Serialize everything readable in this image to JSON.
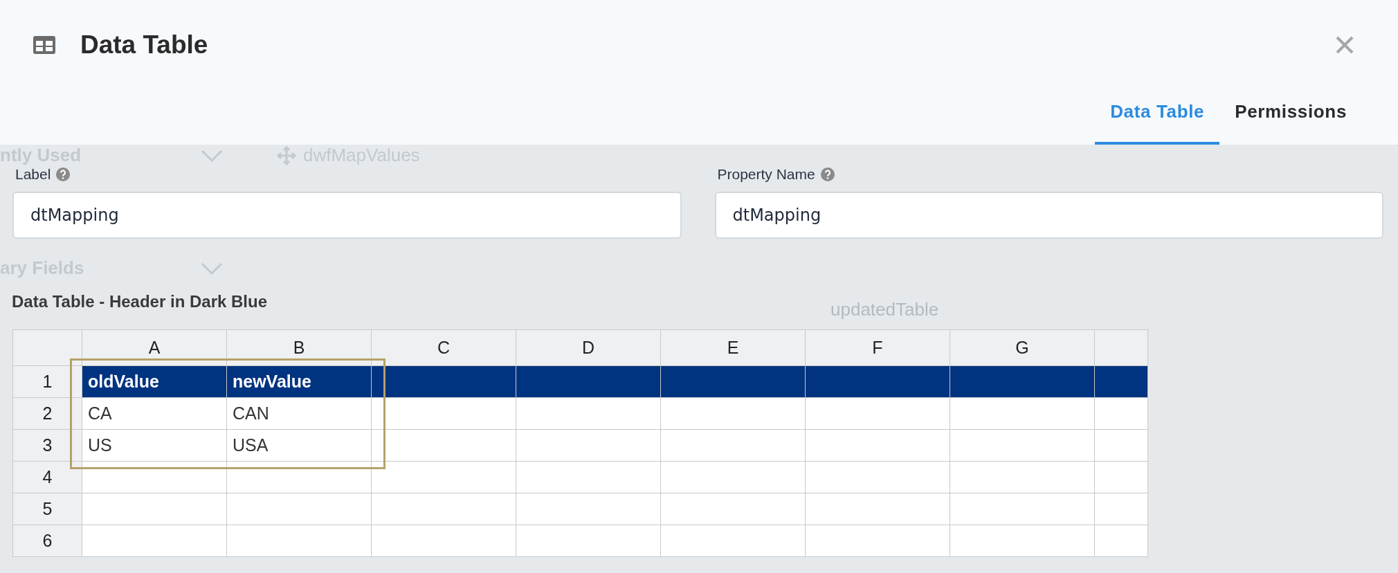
{
  "background": [
    {
      "text": "ntly Used",
      "kind": "section"
    },
    {
      "text": "ary Fields",
      "kind": "section"
    },
    {
      "text": "dwfMapValues",
      "kind": "component"
    },
    {
      "text": "updatedTable",
      "kind": "plain"
    }
  ],
  "dialog": {
    "title": "Data Table",
    "tabs": [
      {
        "label": "Data Table",
        "selected": true
      },
      {
        "label": "Permissions",
        "selected": false
      }
    ],
    "fields": [
      {
        "label": "Label",
        "value": "dtMapping"
      },
      {
        "label": "Property Name",
        "value": "dtMapping"
      }
    ],
    "table_caption": "Data Table - Header in Dark Blue",
    "table": {
      "columns": [
        "A",
        "B",
        "C",
        "D",
        "E",
        "F",
        "G"
      ],
      "rows": [
        {
          "number": "1",
          "kind": "header",
          "cells": [
            "oldValue",
            "newValue"
          ]
        },
        {
          "number": "2",
          "kind": "data",
          "cells": [
            "CA",
            "CAN"
          ]
        },
        {
          "number": "3",
          "kind": "data",
          "cells": [
            "US",
            "USA"
          ]
        },
        {
          "number": "4",
          "kind": "data",
          "cells": []
        },
        {
          "number": "5",
          "kind": "data",
          "cells": []
        },
        {
          "number": "6",
          "kind": "data",
          "cells": []
        }
      ]
    }
  }
}
